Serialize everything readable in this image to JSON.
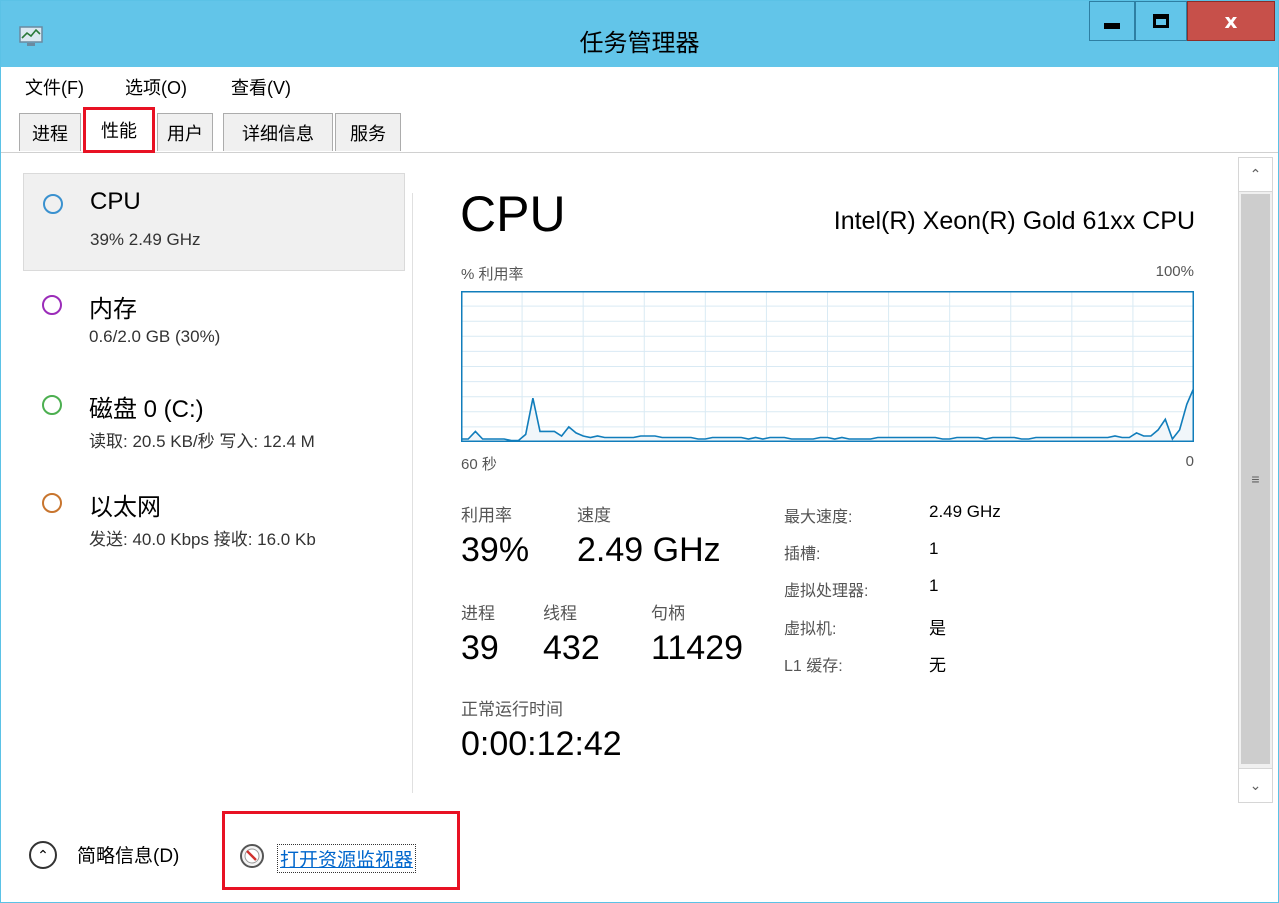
{
  "window": {
    "title": "任务管理器",
    "close_symbol": "x"
  },
  "menu": [
    {
      "label": "文件(F)"
    },
    {
      "label": "选项(O)"
    },
    {
      "label": "查看(V)"
    }
  ],
  "tabs": [
    {
      "label": "进程"
    },
    {
      "label": "性能",
      "active": true
    },
    {
      "label": "用户"
    },
    {
      "label": "详细信息"
    },
    {
      "label": "服务"
    }
  ],
  "sidebar": [
    {
      "title": "CPU",
      "subtitle": "39% 2.49 GHz",
      "color": "#3a91cf",
      "selected": true
    },
    {
      "title": "内存",
      "subtitle": "0.6/2.0 GB (30%)",
      "color": "#9b2cb9"
    },
    {
      "title": "磁盘 0 (C:)",
      "subtitle": "读取: 20.5 KB/秒 写入: 12.4 M",
      "color": "#4caf50"
    },
    {
      "title": "以太网",
      "subtitle": "发送: 40.0 Kbps 接收: 16.0 Kb",
      "color": "#c8752e"
    }
  ],
  "detail": {
    "heading": "CPU",
    "model": "Intel(R) Xeon(R) Gold 61xx CPU",
    "graph_label": "% 利用率",
    "graph_max": "100%",
    "time_left": "60 秒",
    "time_right": "0",
    "utilization_label": "利用率",
    "utilization": "39%",
    "speed_label": "速度",
    "speed": "2.49 GHz",
    "processes_label": "进程",
    "processes": "39",
    "threads_label": "线程",
    "threads": "432",
    "handles_label": "句柄",
    "handles": "11429",
    "uptime_label": "正常运行时间",
    "uptime": "0:00:12:42",
    "specs": [
      {
        "label": "最大速度:",
        "value": "2.49 GHz"
      },
      {
        "label": "插槽:",
        "value": "1"
      },
      {
        "label": "虚拟处理器:",
        "value": "1"
      },
      {
        "label": "虚拟机:",
        "value": "是"
      },
      {
        "label": "L1 缓存:",
        "value": "无"
      }
    ]
  },
  "chart_data": {
    "type": "area",
    "title": "",
    "ylim": [
      0,
      100
    ],
    "series": [
      {
        "values": [
          2,
          2,
          7,
          2,
          2,
          2,
          2,
          1,
          1,
          5,
          29,
          7,
          7,
          7,
          4,
          10,
          6,
          4,
          3,
          4,
          3,
          3,
          3,
          3,
          3,
          4,
          4,
          4,
          3,
          3,
          3,
          3,
          3,
          2,
          2,
          3,
          3,
          3,
          3,
          3,
          2,
          3,
          2,
          3,
          3,
          3,
          2,
          2,
          2,
          2,
          3,
          3,
          2,
          3,
          2,
          2,
          2,
          2,
          3,
          3,
          3,
          3,
          3,
          3,
          3,
          3,
          3,
          2,
          2,
          3,
          3,
          3,
          3,
          2,
          3,
          3,
          3,
          3,
          2,
          2,
          3,
          3,
          3,
          3,
          3,
          3,
          3,
          3,
          3,
          3,
          3,
          4,
          3,
          3,
          6,
          4,
          4,
          8,
          15,
          2,
          8,
          25,
          36
        ]
      }
    ],
    "grid": true,
    "color": "#117dbb"
  },
  "footer": {
    "collapse_label": "简略信息(D)",
    "resmon_label": "打开资源监视器"
  }
}
